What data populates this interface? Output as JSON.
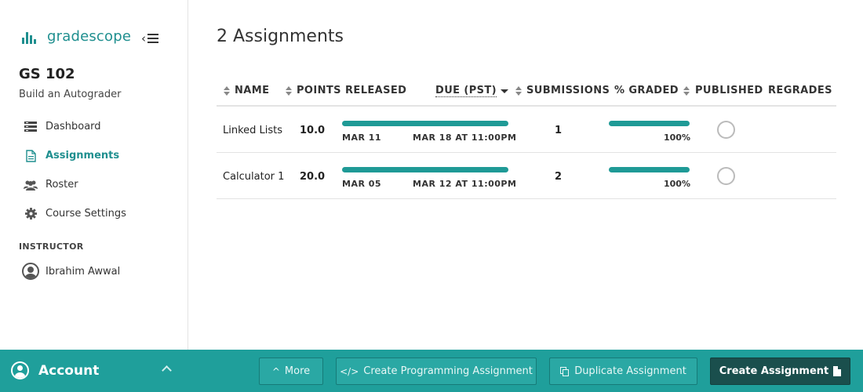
{
  "brand": {
    "name": "gradescope"
  },
  "course": {
    "title": "GS 102",
    "subtitle": "Build an Autograder"
  },
  "nav": {
    "items": [
      {
        "label": "Dashboard",
        "icon": "dashboard-icon"
      },
      {
        "label": "Assignments",
        "icon": "document-icon",
        "active": true
      },
      {
        "label": "Roster",
        "icon": "users-icon"
      },
      {
        "label": "Course Settings",
        "icon": "gear-icon"
      }
    ]
  },
  "instructor": {
    "section_label": "INSTRUCTOR",
    "name": "Ibrahim Awwal"
  },
  "main": {
    "title": "2 Assignments"
  },
  "table": {
    "headers": {
      "name": "NAME",
      "points": "POINTS",
      "released": "RELEASED",
      "due": "DUE (PST)",
      "submissions": "SUBMISSIONS",
      "graded": "% GRADED",
      "published": "PUBLISHED",
      "regrades": "REGRADES"
    },
    "rows": [
      {
        "name": "Linked Lists",
        "points": "10.0",
        "released": "MAR 11",
        "due": "MAR 18 AT 11:00PM",
        "submissions": "1",
        "graded": "100%",
        "published": false
      },
      {
        "name": "Calculator 1",
        "points": "20.0",
        "released": "MAR 05",
        "due": "MAR 12 AT 11:00PM",
        "submissions": "2",
        "graded": "100%",
        "published": false
      }
    ]
  },
  "footer": {
    "account_label": "Account",
    "more_label": "More",
    "create_programming_label": "Create Programming Assignment",
    "duplicate_label": "Duplicate Assignment",
    "create_label": "Create Assignment"
  },
  "colors": {
    "accent": "#1f9f9b",
    "brand": "#1f8f8f",
    "primary_button": "#1a4f4d"
  }
}
